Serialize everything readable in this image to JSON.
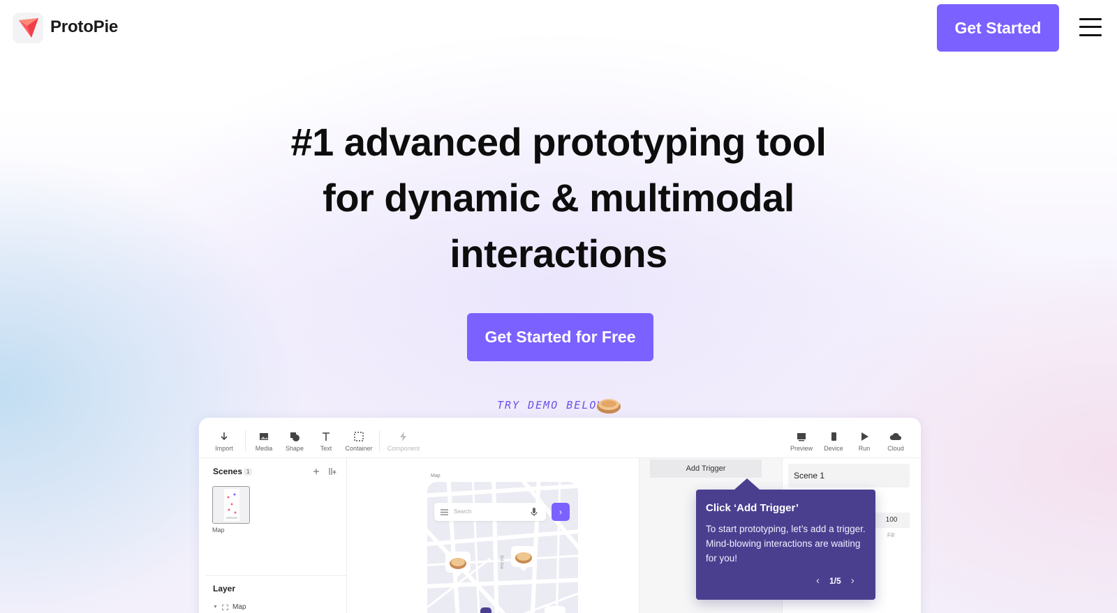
{
  "header": {
    "brand": "ProtoPie",
    "get_started": "Get Started"
  },
  "hero": {
    "headline_lines": [
      "#1 advanced prototyping tool",
      "for dynamic & multimodal",
      "interactions"
    ],
    "cta": "Get Started for Free",
    "demo_label": "TRY DEMO BELOW"
  },
  "editor": {
    "toolbar_left": [
      {
        "label": "Import",
        "icon": "import-icon"
      },
      {
        "label": "Media",
        "icon": "media-icon"
      },
      {
        "label": "Shape",
        "icon": "shape-icon"
      },
      {
        "label": "Text",
        "icon": "text-icon"
      },
      {
        "label": "Container",
        "icon": "container-icon"
      },
      {
        "label": "Component",
        "icon": "component-icon"
      }
    ],
    "toolbar_right": [
      {
        "label": "Preview",
        "icon": "preview-icon"
      },
      {
        "label": "Device",
        "icon": "device-icon"
      },
      {
        "label": "Run",
        "icon": "run-icon"
      },
      {
        "label": "Cloud",
        "icon": "cloud-icon"
      }
    ],
    "scenes": {
      "title": "Scenes",
      "count": "1",
      "items": [
        {
          "name": "Map"
        }
      ]
    },
    "layer": {
      "title": "Layer",
      "items": [
        {
          "name": "Map"
        }
      ]
    },
    "canvas": {
      "frame_label": "Map",
      "search_placeholder": "Search",
      "road_label": "3rd Ave"
    },
    "inspector": {
      "add_trigger": "Add Trigger",
      "scene_name": "Scene 1",
      "opacity_value": "100",
      "fill_label": "Fill"
    }
  },
  "tooltip": {
    "title": "Click ‘Add Trigger’",
    "body": "To start prototyping, let’s add a trigger. Mind-blowing interactions are waiting for you!",
    "page": "1/5"
  },
  "colors": {
    "accent": "#7b61ff",
    "tooltip_bg": "#4a3f8f"
  }
}
